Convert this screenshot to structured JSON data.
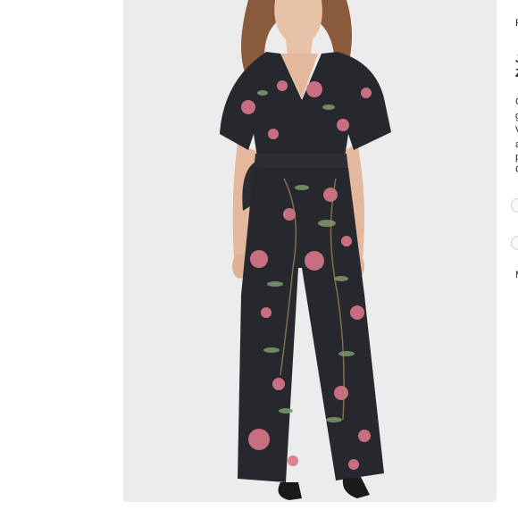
{
  "side_panel": {
    "line1": "F",
    "line2": "J",
    "line3": "Z",
    "para": [
      "C",
      "g",
      "V",
      "a",
      "p",
      "C"
    ],
    "lower": "M"
  },
  "colors": {
    "photo_bg": "#ececec",
    "garment_bg": "#26282e",
    "floral_pink": "#d9778a",
    "floral_green": "#7d9a6f"
  }
}
